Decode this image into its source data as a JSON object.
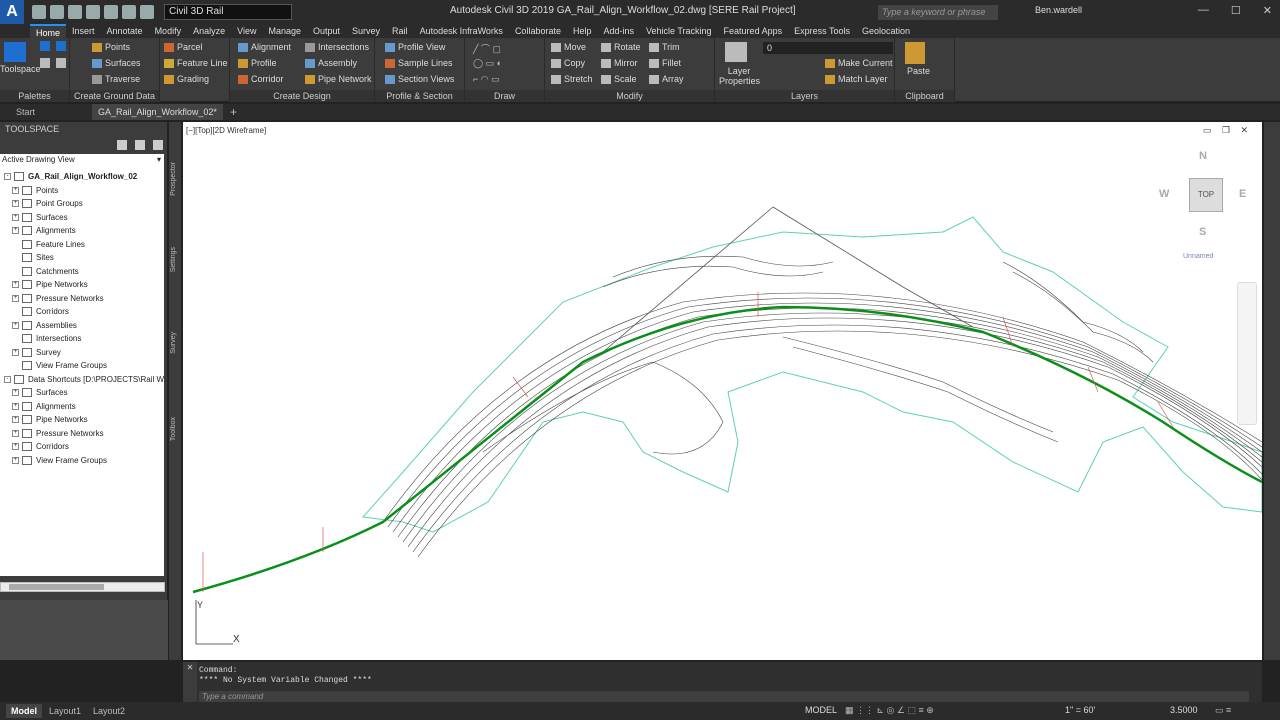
{
  "title_bar": {
    "app_logo": "A",
    "workspace": "Civil 3D Rail",
    "window_title": "Autodesk Civil 3D 2019    GA_Rail_Align_Workflow_02.dwg [SERE Rail Project]",
    "search_placeholder": "Type a keyword or phrase",
    "user": "Ben.wardell"
  },
  "ribbon_tabs": [
    "Home",
    "Insert",
    "Annotate",
    "Modify",
    "Analyze",
    "View",
    "Manage",
    "Output",
    "Survey",
    "Rail",
    "Autodesk InfraWorks",
    "Collaborate",
    "Help",
    "Add-ins",
    "Vehicle Tracking",
    "Featured Apps",
    "Express Tools",
    "Geolocation"
  ],
  "ribbon": {
    "toolspace": "Toolspace",
    "palettes": "Palettes",
    "ground": {
      "title": "Create Ground Data",
      "points": "Points",
      "surfaces": "Surfaces",
      "traverse": "Traverse",
      "parcel": "Parcel",
      "feature_line": "Feature Line",
      "grading": "Grading"
    },
    "design": {
      "title": "Create Design",
      "alignment": "Alignment",
      "profile": "Profile",
      "corridor": "Corridor",
      "intersections": "Intersections",
      "assembly": "Assembly",
      "pipe_network": "Pipe Network"
    },
    "profile_section": {
      "title": "Profile & Section Views",
      "profile_view": "Profile View",
      "sample_lines": "Sample Lines",
      "section_views": "Section Views"
    },
    "draw": {
      "title": "Draw"
    },
    "modify": {
      "title": "Modify",
      "move": "Move",
      "rotate": "Rotate",
      "trim": "Trim",
      "copy": "Copy",
      "mirror": "Mirror",
      "fillet": "Fillet",
      "stretch": "Stretch",
      "scale": "Scale",
      "array": "Array"
    },
    "layers": {
      "title": "Layers",
      "layer_properties": "Layer Properties",
      "current_layer": "0",
      "make_current": "Make Current",
      "match_layer": "Match Layer"
    },
    "clipboard": {
      "title": "Clipboard",
      "paste": "Paste"
    }
  },
  "doc_tabs": {
    "start": "Start",
    "active": "GA_Rail_Align_Workflow_02*",
    "plus": "+"
  },
  "toolspace": {
    "title": "TOOLSPACE",
    "view_select": "Active Drawing View",
    "tree": [
      {
        "label": "GA_Rail_Align_Workflow_02",
        "level": 0,
        "exp": "-"
      },
      {
        "label": "Points",
        "level": 1,
        "exp": "+"
      },
      {
        "label": "Point Groups",
        "level": 1,
        "exp": "+"
      },
      {
        "label": "Surfaces",
        "level": 1,
        "exp": "+"
      },
      {
        "label": "Alignments",
        "level": 1,
        "exp": "+"
      },
      {
        "label": "Feature Lines",
        "level": 1,
        "exp": ""
      },
      {
        "label": "Sites",
        "level": 1,
        "exp": ""
      },
      {
        "label": "Catchments",
        "level": 1,
        "exp": ""
      },
      {
        "label": "Pipe Networks",
        "level": 1,
        "exp": "+"
      },
      {
        "label": "Pressure Networks",
        "level": 1,
        "exp": "+"
      },
      {
        "label": "Corridors",
        "level": 1,
        "exp": ""
      },
      {
        "label": "Assemblies",
        "level": 1,
        "exp": "+"
      },
      {
        "label": "Intersections",
        "level": 1,
        "exp": ""
      },
      {
        "label": "Survey",
        "level": 1,
        "exp": "+"
      },
      {
        "label": "View Frame Groups",
        "level": 1,
        "exp": ""
      },
      {
        "label": "Data Shortcuts [D:\\PROJECTS\\Rail W...",
        "level": 0,
        "exp": "-"
      },
      {
        "label": "Surfaces",
        "level": 1,
        "exp": "+"
      },
      {
        "label": "Alignments",
        "level": 1,
        "exp": "+"
      },
      {
        "label": "Pipe Networks",
        "level": 1,
        "exp": "+"
      },
      {
        "label": "Pressure Networks",
        "level": 1,
        "exp": "+"
      },
      {
        "label": "Corridors",
        "level": 1,
        "exp": "+"
      },
      {
        "label": "View Frame Groups",
        "level": 1,
        "exp": "+"
      }
    ],
    "side_tabs": [
      "Prospector",
      "Settings",
      "Survey",
      "Toolbox"
    ]
  },
  "viewport": {
    "label": "[−][Top][2D Wireframe]",
    "cube_face": "TOP",
    "compass": {
      "n": "N",
      "s": "S",
      "e": "E",
      "w": "W"
    },
    "ucs_name": "Unnamed",
    "axis_y": "Y",
    "axis_x": "X"
  },
  "command": {
    "line1": "Command:",
    "line2": "**** No System Variable Changed ****",
    "placeholder": "Type a command"
  },
  "status": {
    "tabs": [
      "Model",
      "Layout1",
      "Layout2"
    ],
    "model": "MODEL",
    "scale": "1\" = 60'",
    "elevation": "3.5000"
  }
}
